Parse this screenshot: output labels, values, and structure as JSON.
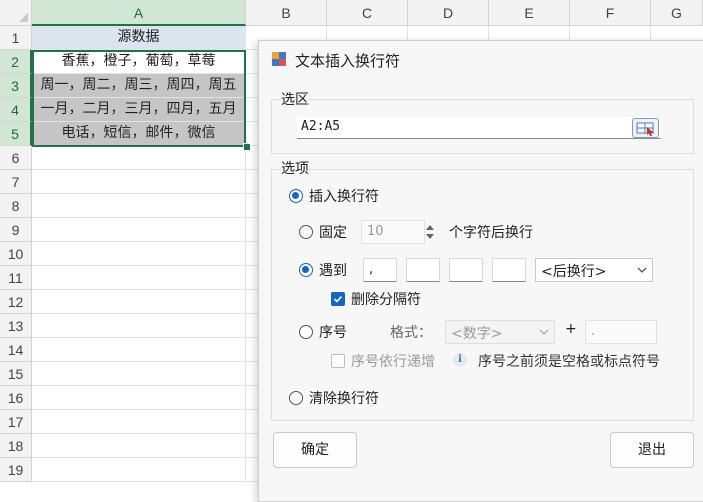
{
  "spreadsheet": {
    "columns": [
      "A",
      "B",
      "C",
      "D",
      "E",
      "F",
      "G"
    ],
    "rows": [
      "1",
      "2",
      "3",
      "4",
      "5",
      "6",
      "7",
      "8",
      "9",
      "10",
      "11",
      "12",
      "13",
      "14",
      "15",
      "16",
      "17",
      "18",
      "19"
    ],
    "cells": {
      "a1": "源数据",
      "a2": "香蕉，橙子，葡萄，草莓",
      "a3": "周一，周二，周三，周四，周五",
      "a4": "一月，二月，三月，四月，五月",
      "a5": "电话，短信，邮件，微信"
    }
  },
  "dialog": {
    "title": "文本插入换行符",
    "selection_group": {
      "label": "选区",
      "range_value": "A2:A5"
    },
    "options_group": {
      "label": "选项",
      "insert_linebreak": "插入换行符",
      "fixed_label": "固定",
      "fixed_value": "10",
      "fixed_suffix": "个字符后换行",
      "encounter_label": "遇到",
      "encounter_values": [
        ",",
        "",
        "",
        ""
      ],
      "position_select": "<后换行>",
      "delete_separator": "删除分隔符",
      "serial_label": "序号",
      "format_label": "格式：",
      "format_select": "<数字>",
      "plus": "+",
      "suffix_value": ".",
      "serial_increment": "序号依行递增",
      "serial_hint": "序号之前须是空格或标点符号",
      "clear_linebreak": "清除换行符"
    },
    "ok_label": "确定",
    "exit_label": "退出"
  },
  "colors": {
    "accent": "#1466c0",
    "excel_green": "#217346",
    "header_fill": "#dce4f0",
    "shaded_fill": "#c5c5c5"
  }
}
